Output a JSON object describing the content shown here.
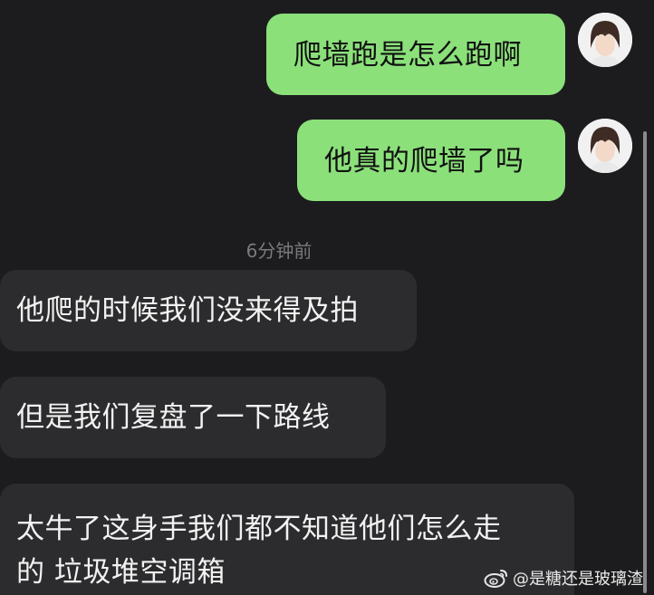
{
  "chat": {
    "messages": [
      {
        "direction": "outgoing",
        "text": "爬墙跑是怎么跑啊"
      },
      {
        "direction": "outgoing",
        "text": "他真的爬墙了吗"
      },
      {
        "direction": "incoming",
        "text": "他爬的时候我们没来得及拍"
      },
      {
        "direction": "incoming",
        "text": "但是我们复盘了一下路线"
      },
      {
        "direction": "incoming",
        "text_line1": "太牛了这身手我们都不知道他们怎么走",
        "text_line2": "的 垃圾堆空调箱"
      }
    ],
    "timestamp": "6分钟前"
  },
  "watermark": {
    "text": "@是糖还是玻璃渣",
    "icon": "weibo-icon"
  },
  "colors": {
    "background": "#1c1c1e",
    "outgoing_bubble": "#8be07a",
    "incoming_bubble": "#2c2c2e",
    "timestamp": "#7a7a7e"
  }
}
